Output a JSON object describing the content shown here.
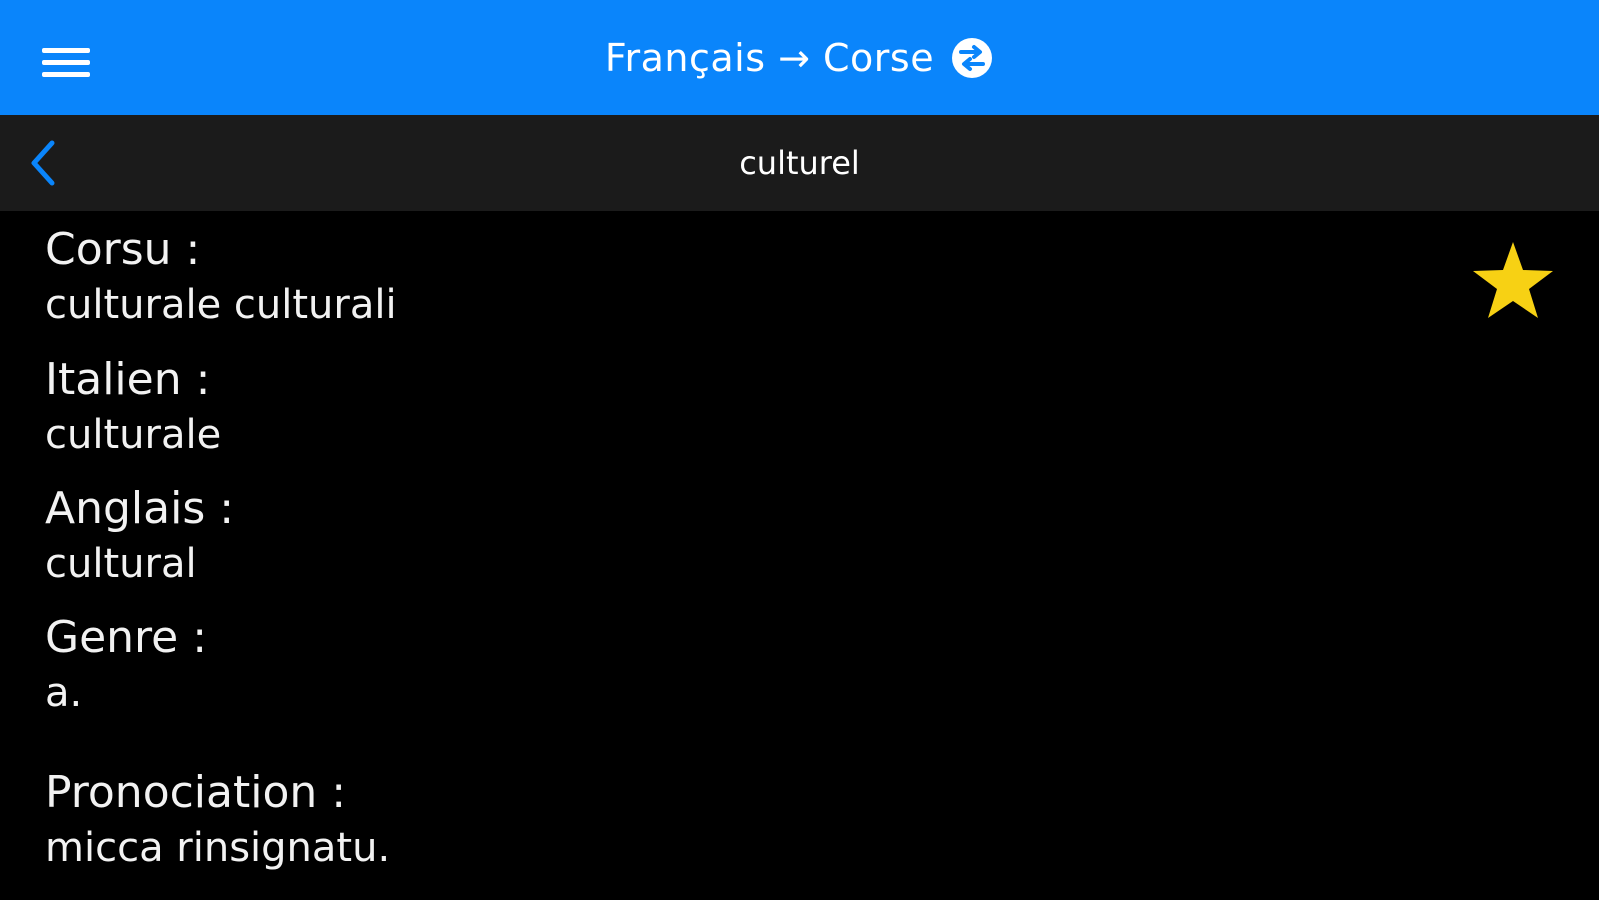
{
  "header": {
    "title": "Français → Corse",
    "menu_icon": "hamburger-menu-icon",
    "swap_icon": "swap-languages-icon",
    "background": "#0a85fb"
  },
  "subheader": {
    "word": "culturel",
    "back_icon": "chevron-left-icon",
    "accent": "#0a85fb"
  },
  "favorite": {
    "icon": "star-icon",
    "color": "#f7d114",
    "active": true
  },
  "entries": [
    {
      "label": "Corsu :",
      "value": "culturale culturali"
    },
    {
      "label": "Italien :",
      "value": "culturale"
    },
    {
      "label": "Anglais :",
      "value": "cultural"
    },
    {
      "label": "Genre :",
      "value": "a."
    },
    {
      "label": "Pronociation :",
      "value": "micca rinsignatu."
    }
  ]
}
